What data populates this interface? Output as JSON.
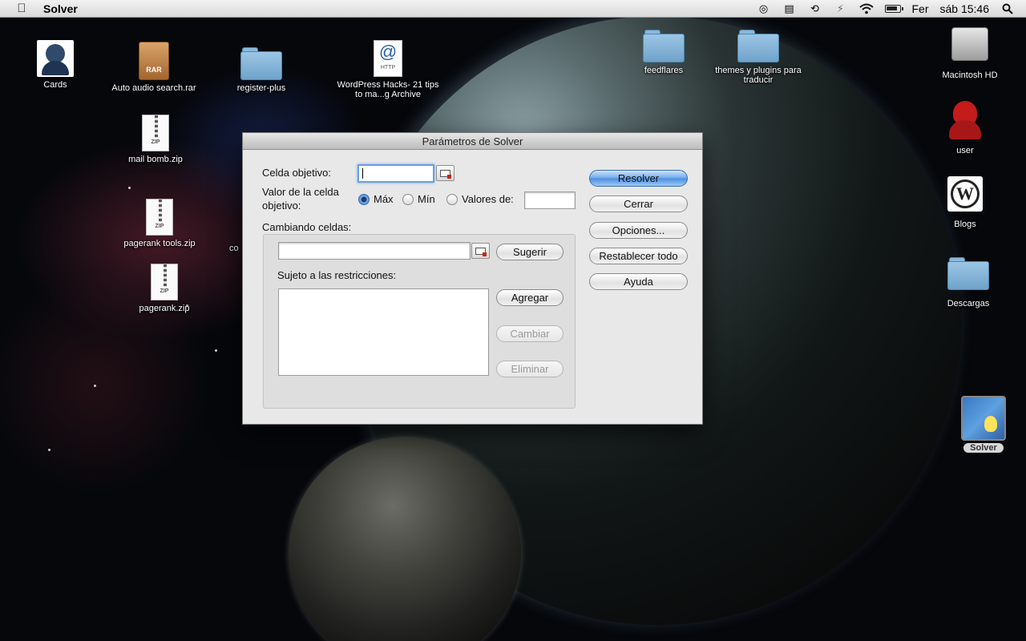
{
  "menubar": {
    "apple_icon": "apple-logo-icon",
    "app_name": "Solver",
    "status_icons": [
      "compass-icon",
      "script-icon",
      "time-machine-icon",
      "bluetooth-icon",
      "wifi-icon",
      "battery-icon"
    ],
    "day": "Fer",
    "clock": "sáb 15:46",
    "spotlight_icon": "spotlight-search-icon"
  },
  "desktop": {
    "icons": {
      "cards": "Cards",
      "auto_audio": "Auto audio search.rar",
      "register_plus": "register-plus",
      "wordpress_hacks": "WordPress Hacks- 21 tips to ma...g Archive",
      "feedflares": "feedflares",
      "themes": "themes y plugins para traducir",
      "macintosh_hd": "Macintosh HD",
      "user": "user",
      "blogs": "Blogs",
      "descargas": "Descargas",
      "mail_bomb": "mail bomb.zip",
      "pagerank_tools": "pagerank tools.zip",
      "pagerank": "pagerank.zip",
      "partial_label": "co",
      "solver": "Solver"
    },
    "badges": {
      "rar": "RAR",
      "zip": "ZIP",
      "http": "HTTP",
      "at": "@",
      "wp": "W"
    }
  },
  "dialog": {
    "title": "Parámetros de Solver",
    "target_cell_label": "Celda objetivo:",
    "target_cell_value": "",
    "value_label_line1": "Valor de la celda",
    "value_label_line2": "objetivo:",
    "radio_max": "Máx",
    "radio_min": "Mín",
    "radio_values": "Valores de:",
    "selected_radio": "Máx",
    "values_of_value": "",
    "changing_cells_label": "Cambiando celdas:",
    "changing_cells_value": "",
    "suggest_button": "Sugerir",
    "constraints_label": "Sujeto a las restricciones:",
    "constraints": [],
    "add_button": "Agregar",
    "change_button": "Cambiar",
    "delete_button": "Eliminar",
    "solve_button": "Resolver",
    "close_button": "Cerrar",
    "options_button": "Opciones...",
    "reset_button": "Restablecer todo",
    "help_button": "Ayuda"
  }
}
